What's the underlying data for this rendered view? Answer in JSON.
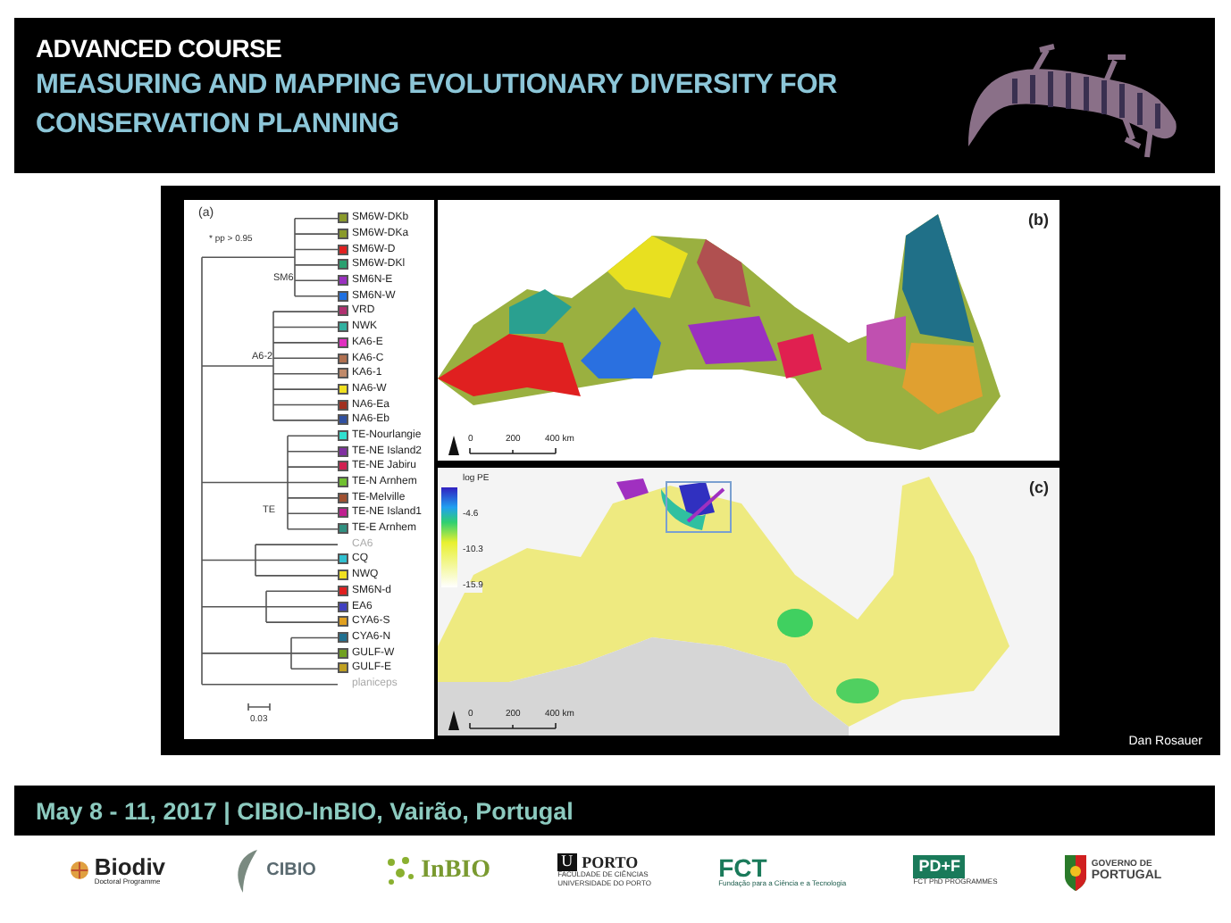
{
  "header": {
    "kicker": "ADVANCED COURSE",
    "title_lines": [
      "MEASURING AND MAPPING EVOLUTIONARY DIVERSITY FOR",
      "CONSERVATION PLANNING"
    ]
  },
  "figure": {
    "tree": {
      "label": "(a)",
      "note": "* pp > 0.95",
      "clades": [
        "SM6",
        "A6-2",
        "TE"
      ],
      "scale": "0.03",
      "leaves": [
        {
          "name": "SM6W-DKb",
          "color": "#8a9a2a"
        },
        {
          "name": "SM6W-DKa",
          "color": "#8a9a2a"
        },
        {
          "name": "SM6W-D",
          "color": "#e02020"
        },
        {
          "name": "SM6W-DKl",
          "color": "#2aa070"
        },
        {
          "name": "SM6N-E",
          "color": "#9a30c0"
        },
        {
          "name": "SM6N-W",
          "color": "#2070e0"
        },
        {
          "name": "VRD",
          "color": "#b03070"
        },
        {
          "name": "NWK",
          "color": "#30b0a0"
        },
        {
          "name": "KA6-E",
          "color": "#e030c0"
        },
        {
          "name": "KA6-C",
          "color": "#b07050"
        },
        {
          "name": "KA6-1",
          "color": "#c08a6a"
        },
        {
          "name": "NA6-W",
          "color": "#f0e020"
        },
        {
          "name": "NA6-Ea",
          "color": "#a03020"
        },
        {
          "name": "NA6-Eb",
          "color": "#3050a0"
        },
        {
          "name": "TE-Nourlangie",
          "color": "#30e0d0"
        },
        {
          "name": "TE-NE Island2",
          "color": "#8030a0"
        },
        {
          "name": "TE-NE Jabiru",
          "color": "#d02050"
        },
        {
          "name": "TE-N Arnhem",
          "color": "#70c030"
        },
        {
          "name": "TE-Melville",
          "color": "#a05030"
        },
        {
          "name": "TE-NE Island1",
          "color": "#c02090"
        },
        {
          "name": "TE-E Arnhem",
          "color": "#309080"
        },
        {
          "name": "CA6"
        },
        {
          "name": "CQ",
          "color": "#30c0d0"
        },
        {
          "name": "NWQ",
          "color": "#f0e020"
        },
        {
          "name": "SM6N-d",
          "color": "#e02020"
        },
        {
          "name": "EA6",
          "color": "#4040c0"
        },
        {
          "name": "CYA6-S",
          "color": "#e0a020"
        },
        {
          "name": "CYA6-N",
          "color": "#207090"
        },
        {
          "name": "GULF-W",
          "color": "#70a020"
        },
        {
          "name": "GULF-E",
          "color": "#c0a020"
        },
        {
          "name": "planiceps"
        }
      ]
    },
    "map_b": {
      "label": "(b)",
      "scale": [
        "0",
        "200",
        "400 km"
      ]
    },
    "map_c": {
      "label": "(c)",
      "legend_title": "log PE",
      "legend_ticks": [
        "-4.6",
        "-10.3",
        "-15.9"
      ],
      "scale": [
        "0",
        "200",
        "400 km"
      ]
    },
    "credit": "Dan Rosauer"
  },
  "footer_bar": {
    "text": "May 8 - 11, 2017 | CIBIO-InBIO, Vairão, Portugal"
  },
  "logos": [
    {
      "kind": "biodiv",
      "lines": [
        "Biodiv",
        "Doctoral Programme"
      ]
    },
    {
      "kind": "cibio",
      "lines": [
        "CIBIO"
      ]
    },
    {
      "kind": "inbio",
      "lines": [
        "InBIO"
      ]
    },
    {
      "kind": "uporto",
      "badge": "U",
      "lines": [
        "PORTO",
        "FACULDADE DE CIÊNCIAS",
        "UNIVERSIDADE DO PORTO"
      ]
    },
    {
      "kind": "fct",
      "lines": [
        "FCT",
        "Fundação para a Ciência e a Tecnologia"
      ]
    },
    {
      "kind": "pdf",
      "lines": [
        "PD+F",
        "FCT PhD PROGRAMMES"
      ]
    },
    {
      "kind": "gov",
      "lines": [
        "GOVERNO DE",
        "PORTUGAL"
      ]
    }
  ]
}
